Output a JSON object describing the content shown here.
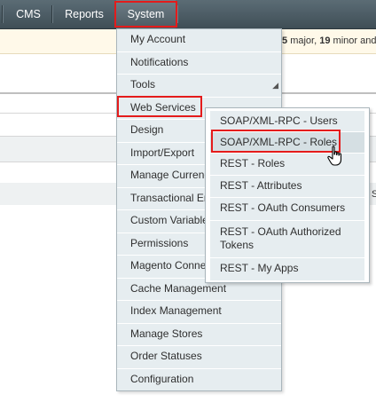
{
  "nav": {
    "cms": "CMS",
    "reports": "Reports",
    "system": "System"
  },
  "notice": {
    "major_count": "5",
    "major_label": "major,",
    "minor_count": "19",
    "minor_label": "minor and"
  },
  "system_menu": {
    "items": [
      {
        "label": "My Account"
      },
      {
        "label": "Notifications"
      },
      {
        "label": "Tools"
      },
      {
        "label": "Web Services"
      },
      {
        "label": "Design"
      },
      {
        "label": "Import/Export"
      },
      {
        "label": "Manage Currency"
      },
      {
        "label": "Transactional Emails"
      },
      {
        "label": "Custom Variables"
      },
      {
        "label": "Permissions"
      },
      {
        "label": "Magento Connect"
      },
      {
        "label": "Cache Management"
      },
      {
        "label": "Index Management"
      },
      {
        "label": "Manage Stores"
      },
      {
        "label": "Order Statuses"
      },
      {
        "label": "Configuration"
      }
    ]
  },
  "web_services_menu": {
    "items": [
      {
        "label": "SOAP/XML-RPC - Users"
      },
      {
        "label": "SOAP/XML-RPC - Roles"
      },
      {
        "label": "REST - Roles"
      },
      {
        "label": "REST - Attributes"
      },
      {
        "label": "REST - OAuth Consumers"
      },
      {
        "label": "REST - OAuth Authorized Tokens"
      },
      {
        "label": "REST - My Apps"
      }
    ]
  },
  "background": {
    "s_letter": "S"
  },
  "colors": {
    "highlight_border": "#e41b1b",
    "nav_bg": "#4a5961",
    "menu_bg": "#e6edf0"
  }
}
